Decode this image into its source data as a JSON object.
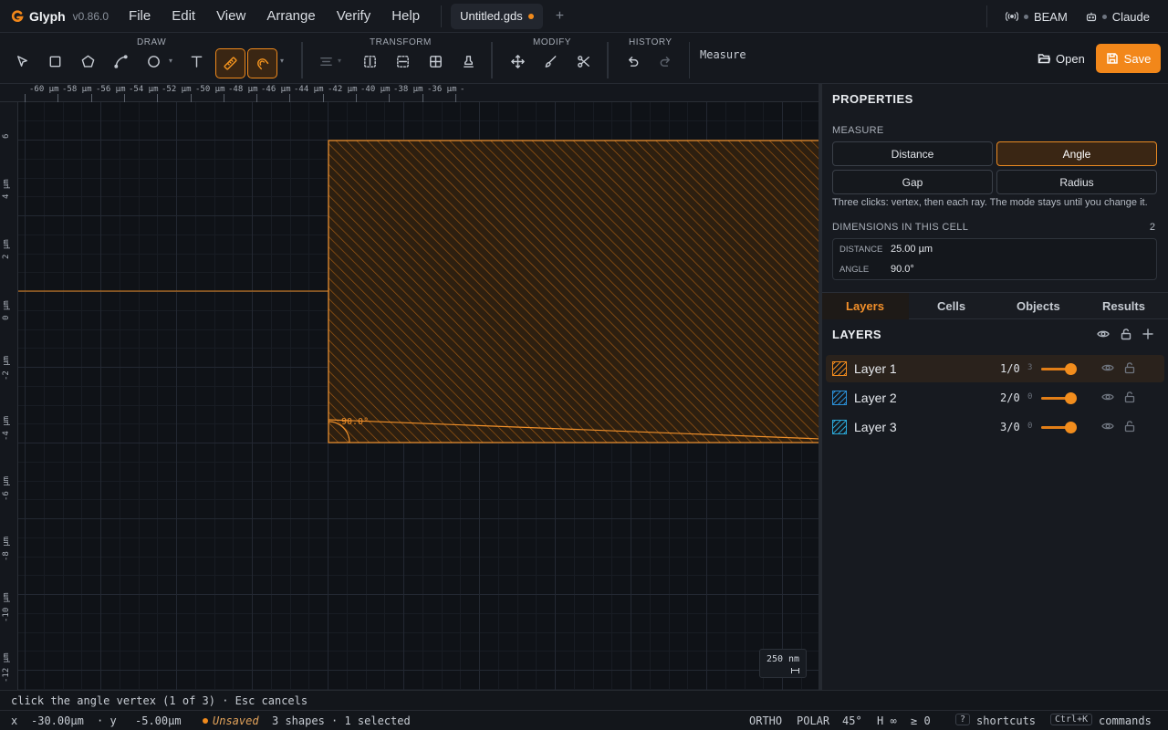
{
  "app": {
    "name": "Glyph",
    "version": "v0.86.0",
    "brand_color": "#f2871a"
  },
  "menu": [
    "File",
    "Edit",
    "View",
    "Arrange",
    "Verify",
    "Help"
  ],
  "file_tab": {
    "name": "Untitled.gds",
    "add_icon": "plus-icon"
  },
  "connections": [
    {
      "icon": "broadcast-icon",
      "label": "BEAM"
    },
    {
      "icon": "robot-icon",
      "label": "Claude"
    }
  ],
  "toolbar": {
    "groups": {
      "draw": "DRAW",
      "transform": "TRANSFORM",
      "modify": "MODIFY",
      "history": "HISTORY"
    },
    "active_tool_label": "Measure",
    "open_label": "Open",
    "save_label": "Save"
  },
  "canvas": {
    "x_ticks": [
      "-60 µm",
      "-58 µm",
      "-56 µm",
      "-54 µm",
      "-52 µm",
      "-50 µm",
      "-48 µm",
      "-46 µm",
      "-44 µm",
      "-42 µm",
      "-40 µm",
      "-38 µm",
      "-36 µm",
      "-"
    ],
    "y_ticks": [
      "6",
      "4 µm",
      "2 µm",
      "0 µm",
      "-2 µm",
      "-4 µm",
      "-6 µm",
      "-8 µm",
      "-10 µm",
      "-12 µm",
      "µm"
    ],
    "angle_label": "90.0°",
    "scale_bar": "250 nm"
  },
  "properties": {
    "title": "PROPERTIES",
    "measure_label": "MEASURE",
    "modes": [
      "Distance",
      "Angle",
      "Gap",
      "Radius"
    ],
    "active_mode": "Angle",
    "hint": "Three clicks: vertex, then each ray. The mode stays until you change it.",
    "dimensions_label": "DIMENSIONS IN THIS CELL",
    "dimensions_count": "2",
    "dimensions": [
      {
        "kind": "DISTANCE",
        "value": "25.00 µm"
      },
      {
        "kind": "ANGLE",
        "value": "90.0°"
      }
    ]
  },
  "panel_tabs": [
    "Layers",
    "Cells",
    "Objects",
    "Results"
  ],
  "active_panel_tab": "Layers",
  "layers": {
    "title": "LAYERS",
    "items": [
      {
        "name": "Layer 1",
        "gds": "1/0",
        "count": "3",
        "color": "#f08a1c",
        "opacity": 0.85,
        "selected": true
      },
      {
        "name": "Layer 2",
        "gds": "2/0",
        "count": "0",
        "color": "#2b8fd6",
        "opacity": 0.85,
        "selected": false
      },
      {
        "name": "Layer 3",
        "gds": "3/0",
        "count": "0",
        "color": "#2ba7d6",
        "opacity": 0.85,
        "selected": false
      }
    ]
  },
  "command_hint": "click the angle vertex (1 of 3) · Esc cancels",
  "status": {
    "x_label": "x",
    "x_value": "-30.00µm",
    "y_label": "· y",
    "y_value": "-5.00µm",
    "unsaved": "Unsaved",
    "shapes": "3 shapes · 1 selected",
    "ortho": "ORTHO",
    "polar": "POLAR",
    "angle_step": "45°",
    "h_value": "H ∞",
    "ge_value": "≥ 0",
    "shortcuts_key": "?",
    "shortcuts_label": "shortcuts",
    "commands_key": "Ctrl+K",
    "commands_label": "commands"
  }
}
